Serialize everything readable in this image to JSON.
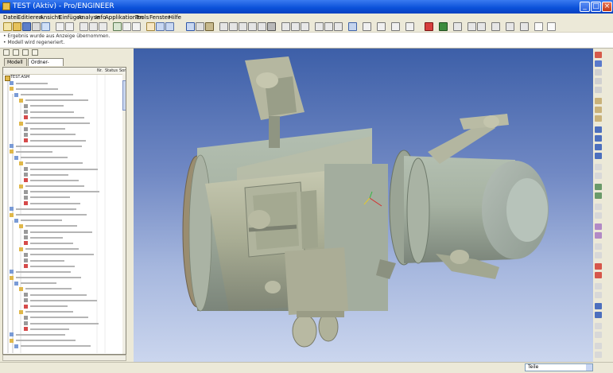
{
  "window": {
    "title": "TEST (Aktiv) - Pro/ENGINEER",
    "minimize": "_",
    "maximize": "□",
    "close": "×"
  },
  "menu": [
    "Datei",
    "Editieren",
    "Ansicht",
    "Einfügen",
    "Analyse",
    "Info",
    "Applikationen",
    "Tools",
    "Fenster",
    "Hilfe"
  ],
  "message_area": {
    "line1": "• Ergebnis wurde aus Anzeige übernommen.",
    "line2": "• Modell wird regeneriert."
  },
  "model_tree": {
    "tabs": [
      "Modell",
      "Ordner-Browser"
    ],
    "active_tab": "Ordner-Browser",
    "columns": [
      "",
      "Nr.",
      "Status",
      "Sort"
    ],
    "root": "TEST.ASM"
  },
  "status": {
    "filter": "Teile"
  }
}
